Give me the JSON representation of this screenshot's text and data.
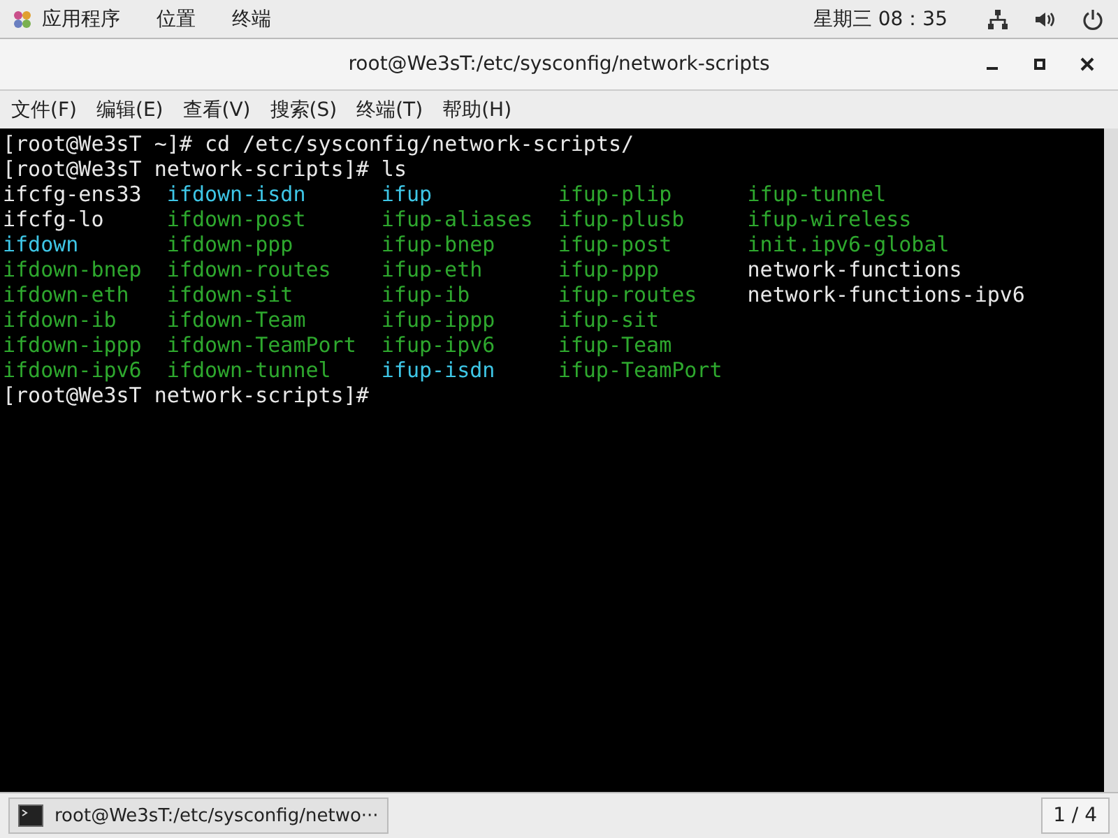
{
  "top_bar": {
    "menus": [
      "应用程序",
      "位置",
      "终端"
    ],
    "clock": "星期三 08：35"
  },
  "window": {
    "title": "root@We3sT:/etc/sysconfig/network-scripts"
  },
  "menu_bar": [
    "文件(F)",
    "编辑(E)",
    "查看(V)",
    "搜索(S)",
    "终端(T)",
    "帮助(H)"
  ],
  "terminal": {
    "lines_before": [
      "[root@We3sT ~]# cd /etc/sysconfig/network-scripts/",
      "[root@We3sT network-scripts]# ls"
    ],
    "listing": [
      [
        {
          "name": "ifcfg-ens33",
          "kind": "file"
        },
        {
          "name": "ifdown-isdn",
          "kind": "link"
        },
        {
          "name": "ifup",
          "kind": "link"
        },
        {
          "name": "ifup-plip",
          "kind": "exec"
        },
        {
          "name": "ifup-tunnel",
          "kind": "exec"
        }
      ],
      [
        {
          "name": "ifcfg-lo",
          "kind": "file"
        },
        {
          "name": "ifdown-post",
          "kind": "exec"
        },
        {
          "name": "ifup-aliases",
          "kind": "exec"
        },
        {
          "name": "ifup-plusb",
          "kind": "exec"
        },
        {
          "name": "ifup-wireless",
          "kind": "exec"
        }
      ],
      [
        {
          "name": "ifdown",
          "kind": "link"
        },
        {
          "name": "ifdown-ppp",
          "kind": "exec"
        },
        {
          "name": "ifup-bnep",
          "kind": "exec"
        },
        {
          "name": "ifup-post",
          "kind": "exec"
        },
        {
          "name": "init.ipv6-global",
          "kind": "exec"
        }
      ],
      [
        {
          "name": "ifdown-bnep",
          "kind": "exec"
        },
        {
          "name": "ifdown-routes",
          "kind": "exec"
        },
        {
          "name": "ifup-eth",
          "kind": "exec"
        },
        {
          "name": "ifup-ppp",
          "kind": "exec"
        },
        {
          "name": "network-functions",
          "kind": "file"
        }
      ],
      [
        {
          "name": "ifdown-eth",
          "kind": "exec"
        },
        {
          "name": "ifdown-sit",
          "kind": "exec"
        },
        {
          "name": "ifup-ib",
          "kind": "exec"
        },
        {
          "name": "ifup-routes",
          "kind": "exec"
        },
        {
          "name": "network-functions-ipv6",
          "kind": "file"
        }
      ],
      [
        {
          "name": "ifdown-ib",
          "kind": "exec"
        },
        {
          "name": "ifdown-Team",
          "kind": "exec"
        },
        {
          "name": "ifup-ippp",
          "kind": "exec"
        },
        {
          "name": "ifup-sit",
          "kind": "exec"
        }
      ],
      [
        {
          "name": "ifdown-ippp",
          "kind": "exec"
        },
        {
          "name": "ifdown-TeamPort",
          "kind": "exec"
        },
        {
          "name": "ifup-ipv6",
          "kind": "exec"
        },
        {
          "name": "ifup-Team",
          "kind": "exec"
        }
      ],
      [
        {
          "name": "ifdown-ipv6",
          "kind": "exec"
        },
        {
          "name": "ifdown-tunnel",
          "kind": "exec"
        },
        {
          "name": "ifup-isdn",
          "kind": "link"
        },
        {
          "name": "ifup-TeamPort",
          "kind": "exec"
        }
      ]
    ],
    "lines_after": [
      "[root@We3sT network-scripts]#"
    ]
  },
  "taskbar": {
    "window_button": "root@We3sT:/etc/sysconfig/netwo···",
    "workspace": "1 / 4"
  }
}
